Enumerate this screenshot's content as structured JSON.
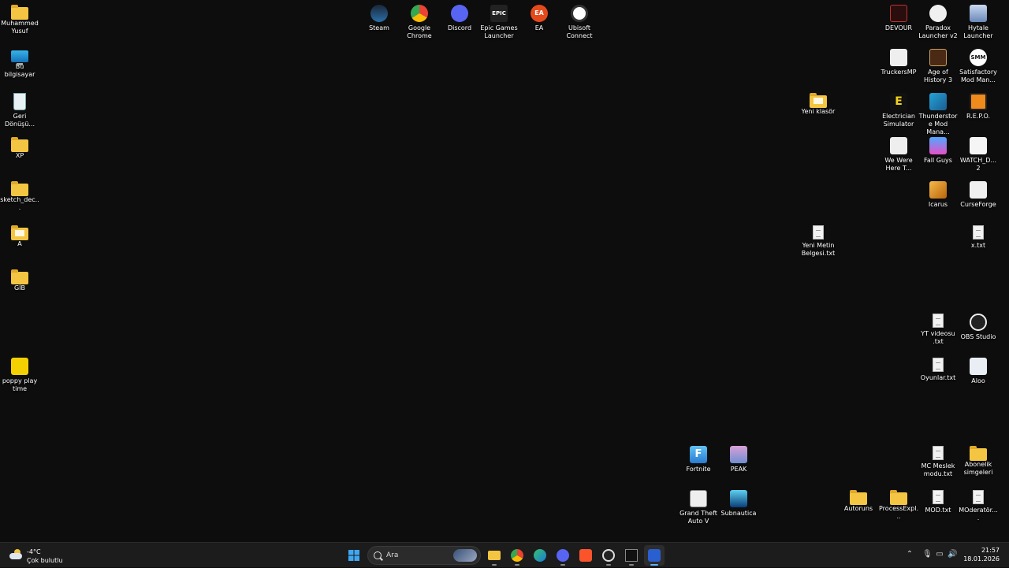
{
  "desktop": {
    "left_col": [
      {
        "label": "Muhammed Yusuf",
        "icon": "folder-icon"
      },
      {
        "label": "Bu bilgisayar",
        "icon": "computer-icon"
      },
      {
        "label": "Geri Dönüşü...",
        "icon": "recycle-bin-icon"
      },
      {
        "label": "XP",
        "icon": "folder-icon"
      },
      {
        "label": "sketch_dec...",
        "icon": "folder-icon"
      },
      {
        "label": "A",
        "icon": "folder-icon"
      },
      {
        "label": "GİB",
        "icon": "folder-icon"
      },
      {
        "label": "poppy play time",
        "icon": "poppy-playtime-icon"
      }
    ],
    "top_row": [
      {
        "label": "Steam",
        "icon": "steam-icon"
      },
      {
        "label": "Google Chrome",
        "icon": "chrome-icon"
      },
      {
        "label": "Discord",
        "icon": "discord-icon"
      },
      {
        "label": "Epic Games Launcher",
        "icon": "epic-games-icon",
        "glyph": "EPIC"
      },
      {
        "label": "EA",
        "icon": "ea-icon",
        "glyph": "EA"
      },
      {
        "label": "Ubisoft Connect",
        "icon": "ubisoft-icon"
      }
    ],
    "right_area": [
      {
        "label": "DEVOUR",
        "icon": "devour-icon"
      },
      {
        "label": "Paradox Launcher v2",
        "icon": "paradox-icon"
      },
      {
        "label": "Hytale Launcher",
        "icon": "hytale-icon"
      },
      {
        "label": "TruckersMP",
        "icon": "truckersmp-icon"
      },
      {
        "label": "Age of History 3",
        "icon": "age-of-history-icon"
      },
      {
        "label": "Satisfactory Mod Man...",
        "icon": "satisfactory-mod-icon",
        "glyph": "SMM"
      },
      {
        "label": "Yeni klasör",
        "icon": "folder-icon"
      },
      {
        "label": "Electrician Simulator",
        "icon": "electrician-icon",
        "glyph": "E"
      },
      {
        "label": "Thunderstore Mod Mana...",
        "icon": "thunderstore-icon"
      },
      {
        "label": "R.E.P.O.",
        "icon": "repo-icon"
      },
      {
        "label": "We Were Here T...",
        "icon": "we-were-here-icon"
      },
      {
        "label": "Fall Guys",
        "icon": "fall-guys-icon"
      },
      {
        "label": "WATCH_D... 2",
        "icon": "watch-dogs-icon"
      },
      {
        "label": "Icarus",
        "icon": "icarus-icon"
      },
      {
        "label": "CurseForge",
        "icon": "curseforge-icon"
      },
      {
        "label": "Yeni Metin Belgesi.txt",
        "icon": "text-file-icon"
      },
      {
        "label": "x.txt",
        "icon": "text-file-icon"
      },
      {
        "label": "YT videosu .txt",
        "icon": "text-file-icon"
      },
      {
        "label": "OBS Studio",
        "icon": "obs-icon"
      },
      {
        "label": "Oyunlar.txt",
        "icon": "text-file-icon"
      },
      {
        "label": "Aloo",
        "icon": "aloo-icon"
      },
      {
        "label": "Fortnite",
        "icon": "fortnite-icon",
        "glyph": "F"
      },
      {
        "label": "PEAK",
        "icon": "peak-icon"
      },
      {
        "label": "MC Meslek modu.txt",
        "icon": "text-file-icon"
      },
      {
        "label": "Abonelik simgeleri",
        "icon": "folder-icon"
      },
      {
        "label": "Grand Theft Auto V",
        "icon": "gta-icon"
      },
      {
        "label": "Subnautica",
        "icon": "subnautica-icon"
      },
      {
        "label": "Autoruns",
        "icon": "folder-icon"
      },
      {
        "label": "ProcessExpl...",
        "icon": "folder-icon"
      },
      {
        "label": "MOD.txt",
        "icon": "text-file-icon"
      },
      {
        "label": "MOderatör....",
        "icon": "text-file-icon"
      }
    ]
  },
  "taskbar": {
    "weather": {
      "temp": "-4°C",
      "condition": "Çok bulutlu"
    },
    "search_placeholder": "Ara",
    "apps": [
      "start-icon",
      "file-explorer-icon",
      "chrome-icon",
      "edge-icon",
      "discord-icon",
      "brave-icon",
      "obs-icon",
      "epic-icon",
      "active-app-icon"
    ],
    "clock": {
      "time": "21:57",
      "date": "18.01.2026"
    }
  },
  "colors": {
    "accent": "#5fb2ff",
    "folder": "#f4c542",
    "background": "#0d0d0d"
  }
}
